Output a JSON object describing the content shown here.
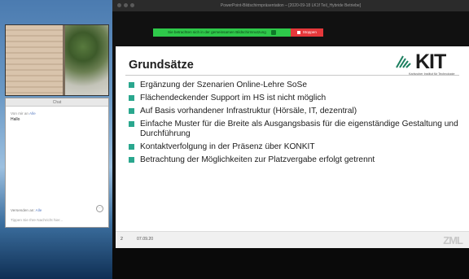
{
  "window": {
    "title": "PowerPoint-Bildschirmpräsentation – [2020-09-18 LK1f Teil_Hybride Betriebe]"
  },
  "share_bar": {
    "message": "Sie betrachten sich in der gemeinsamen Bildschirmnutzung",
    "stop_label": "Stoppen"
  },
  "chat": {
    "title": "Chat",
    "message_meta_from": "Von mir",
    "message_meta_to_label": "an",
    "message_meta_to": "Alle",
    "message_text": "Hallo",
    "send_to_label": "Versenden an:",
    "send_to_value": "Alle",
    "input_placeholder": "Tippen Sie Ihre Nachricht hier..."
  },
  "slide": {
    "title": "Grundsätze",
    "logo_text": "KIT",
    "logo_subtitle": "Karlsruher Institut für Technologie",
    "bullets": [
      "Ergänzung der Szenarien Online-Lehre SoSe",
      "Flächendeckender Support im HS ist nicht möglich",
      "Auf Basis vorhandener Infrastruktur (Hörsäle, IT, dezentral)",
      "Einfache Muster für die Breite als Ausgangsbasis für die eigenständige Gestaltung und Durchführung",
      "Kontaktverfolgung in der Präsenz über KONKIT",
      "Betrachtung der Möglichkeiten zur Platzvergabe erfolgt getrennt"
    ],
    "footer": {
      "page_number": "2",
      "date": "07.09.20",
      "logo": "ZML"
    }
  },
  "colors": {
    "bullet_accent": "#2aa78e",
    "share_green": "#2ec94a",
    "stop_red": "#e5383b"
  }
}
